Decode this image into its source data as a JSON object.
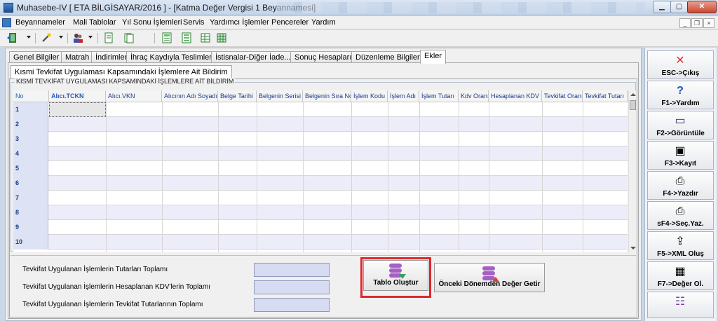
{
  "window": {
    "title": "Muhasebe-IV [ ETA BİLGİSAYAR/2016 ]  - [Katma Değer Vergisi 1 Beyannamesi]",
    "min_glyph": "▁",
    "max_glyph": "▢",
    "close_glyph": "✕"
  },
  "menu": {
    "items": [
      "Beyannameler",
      "Mali Tablolar",
      "Yıl Sonu İşlemleri",
      "Servis",
      "Yardımcı İşlemler",
      "Pencereler",
      "Yardım"
    ],
    "mdi_min": "_",
    "mdi_restore": "❐",
    "mdi_close": "×"
  },
  "tabs": [
    "Genel Bilgiler",
    "Matrah",
    "İndirimler",
    "İhraç Kaydıyla Teslimler",
    "İstisnalar-Diğer İade...",
    "Sonuç Hesapları",
    "Düzenleme Bilgileri",
    "Ekler"
  ],
  "active_tab": "Ekler",
  "subtab": "Kısmi Tevkifat Uygulaması Kapsamındaki İşlemlere Ait Bildirim",
  "groupbox_title": "KISMİ TEVKİFAT UYGULAMASI KAPSAMINDAKİ İŞLEMLERE AİT BİLDİRİM",
  "table": {
    "columns": [
      "No",
      "Alıcı.TCKN",
      "Alıcı.VKN",
      "Alıcının Adı Soyadı/",
      "Belge Tarihi",
      "Belgenin Serisi",
      "Belgenin Sıra No",
      "İşlem Kodu",
      "İşlem Adı",
      "İşlem Tutarı",
      "Kdv Oranı",
      "Hesaplanan KDV",
      "Tevkifat Oranı",
      "Tevkifat Tutarı"
    ],
    "rows": [
      "1",
      "2",
      "3",
      "4",
      "5",
      "6",
      "7",
      "8",
      "9",
      "10"
    ]
  },
  "totals": {
    "labels": [
      "Tevkifat Uygulanan İşlemlerin Tutarları Toplamı",
      "Tevkifat Uygulanan İşlemlerin Hesaplanan KDV'lerin Toplamı",
      "Tevkifat Uygulanan İşlemlerin Tevkifat Tutarlarının Toplamı"
    ],
    "values": [
      "",
      "",
      ""
    ]
  },
  "buttons": {
    "create_table": "Tablo Oluştur",
    "fetch_previous": "Önceki Dönemden Değer Getir"
  },
  "function_keys": [
    {
      "label": "ESC->Çıkış",
      "icon": "exit-icon",
      "glyph": "✕",
      "color": "#d23b3b"
    },
    {
      "label": "F1->Yardım",
      "icon": "help-icon",
      "glyph": "?",
      "color": "#1f55b8"
    },
    {
      "label": "F2->Görüntüle",
      "icon": "monitor-icon",
      "glyph": "▭",
      "color": "#2a2a6a"
    },
    {
      "label": "F3->Kayıt",
      "icon": "floppy-disk-icon",
      "glyph": "▣",
      "color": "#333"
    },
    {
      "label": "F4->Yazdır",
      "icon": "printer-icon",
      "glyph": "⎙",
      "color": "#333"
    },
    {
      "label": "sF4->Seç.Yaz.",
      "icon": "select-print-icon",
      "glyph": "⎙",
      "color": "#333"
    },
    {
      "label": "F5->XML Oluş",
      "icon": "xml-export-icon",
      "glyph": "⇪",
      "color": "#333"
    },
    {
      "label": "F7->Değer Ol.",
      "icon": "calculator-icon",
      "glyph": "▦",
      "color": "#333"
    },
    {
      "label": "",
      "icon": "list-icon",
      "glyph": "☷",
      "color": "#7a3fa0"
    }
  ]
}
